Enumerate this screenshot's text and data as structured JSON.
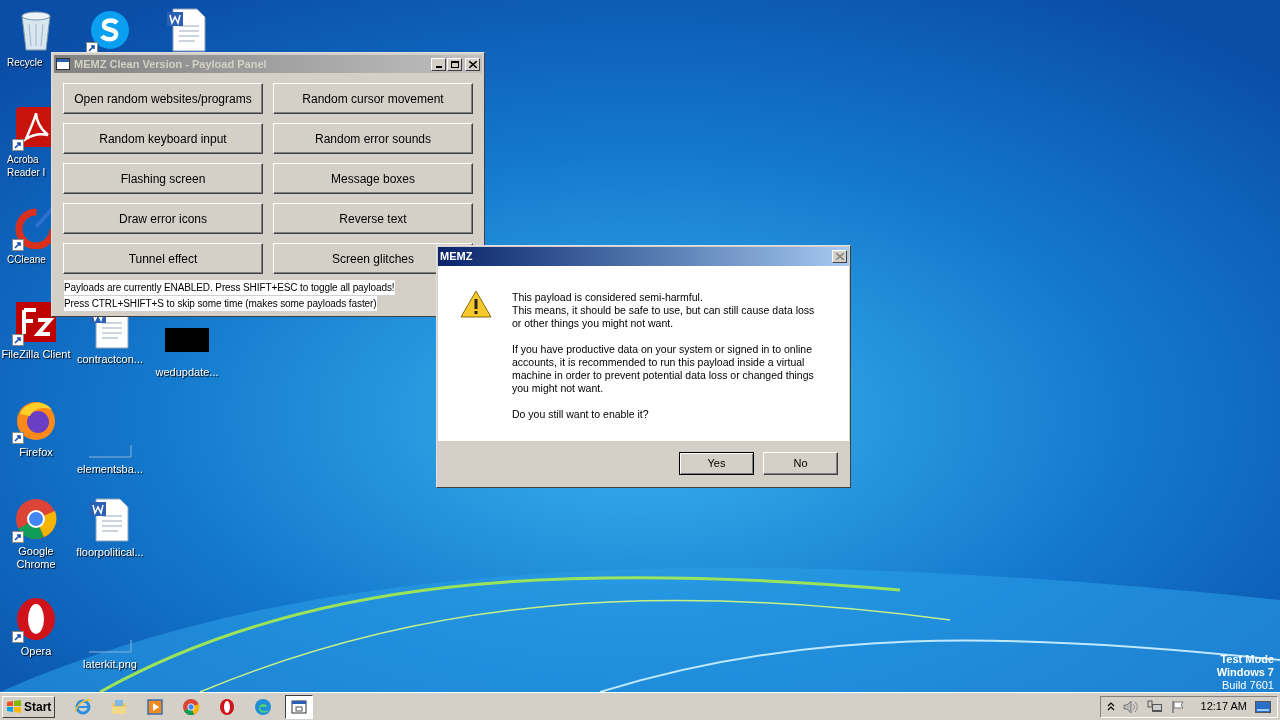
{
  "desktop": {
    "columns": [
      [
        {
          "kind": "recycle",
          "lines": [
            "Recycle"
          ],
          "shortcut": false
        },
        {
          "kind": "pdf",
          "lines": [
            "Acroba",
            "Reader I"
          ],
          "shortcut": true
        },
        {
          "kind": "ccleaner",
          "lines": [
            "CCleane"
          ],
          "shortcut": true
        },
        {
          "kind": "filezilla",
          "lines": [
            "FileZilla Client"
          ],
          "shortcut": true
        },
        {
          "kind": "firefox",
          "lines": [
            "Firefox"
          ],
          "shortcut": true
        },
        {
          "kind": "chrome",
          "lines": [
            "Google",
            "Chrome"
          ],
          "shortcut": true
        },
        {
          "kind": "opera",
          "lines": [
            "Opera"
          ],
          "shortcut": true
        }
      ],
      [
        {
          "kind": "skype",
          "shortcut": true
        },
        {
          "kind": "word",
          "lines": [
            "contractcon..."
          ],
          "shortcut": false
        },
        {
          "kind": "blank",
          "lines": [
            "elementsba..."
          ],
          "shortcut": false
        },
        {
          "kind": "word",
          "lines": [
            "floorpolitical..."
          ],
          "shortcut": false
        },
        {
          "kind": "blank",
          "lines": [
            "laterkit.png"
          ],
          "shortcut": false
        }
      ],
      [
        {
          "kind": "word",
          "shortcut": false
        },
        {
          "kind": "black",
          "lines": [
            "wedupdate..."
          ],
          "shortcut": false
        }
      ]
    ],
    "watermark_lines": [
      "Test Mode",
      "Windows 7",
      "Build 7601"
    ]
  },
  "panel": {
    "title": "MEMZ Clean Version - Payload Panel",
    "active": false,
    "buttons": [
      "Open random websites/programs",
      "Random cursor movement",
      "Random keyboard input",
      "Random error sounds",
      "Flashing screen",
      "Message boxes",
      "Draw error icons",
      "Reverse text",
      "Tunnel effect",
      "Screen glitches"
    ],
    "status_lines": [
      "Payloads are currently ENABLED. Press SHIFT+ESC to toggle all payloads!",
      "Press CTRL+SHIFT+S to skip some time (makes some payloads faster)"
    ]
  },
  "dialog": {
    "title": "MEMZ",
    "active": true,
    "paragraphs": [
      "This payload is considered semi-harmful.\nThis means, it should be safe to use, but can still cause data loss\nor other things you might not want.",
      "If you have productive data on your system or signed in to online\naccounts, it is recommended to run this payload inside a virtual\nmachine in order to prevent potential data loss or changed things\nyou might not want.",
      "Do you still want to enable it?"
    ],
    "buttons": [
      {
        "label": "Yes",
        "selected": true
      },
      {
        "label": "No",
        "selected": false
      }
    ]
  },
  "taskbar": {
    "start": "Start",
    "items": [
      {
        "kind": "ie",
        "selected": false
      },
      {
        "kind": "explorer",
        "selected": false
      },
      {
        "kind": "media",
        "selected": false
      },
      {
        "kind": "chrome",
        "selected": false
      },
      {
        "kind": "opera",
        "selected": false
      },
      {
        "kind": "edge",
        "selected": false
      },
      {
        "kind": "window",
        "selected": true
      }
    ],
    "clock": "12:17 AM"
  }
}
